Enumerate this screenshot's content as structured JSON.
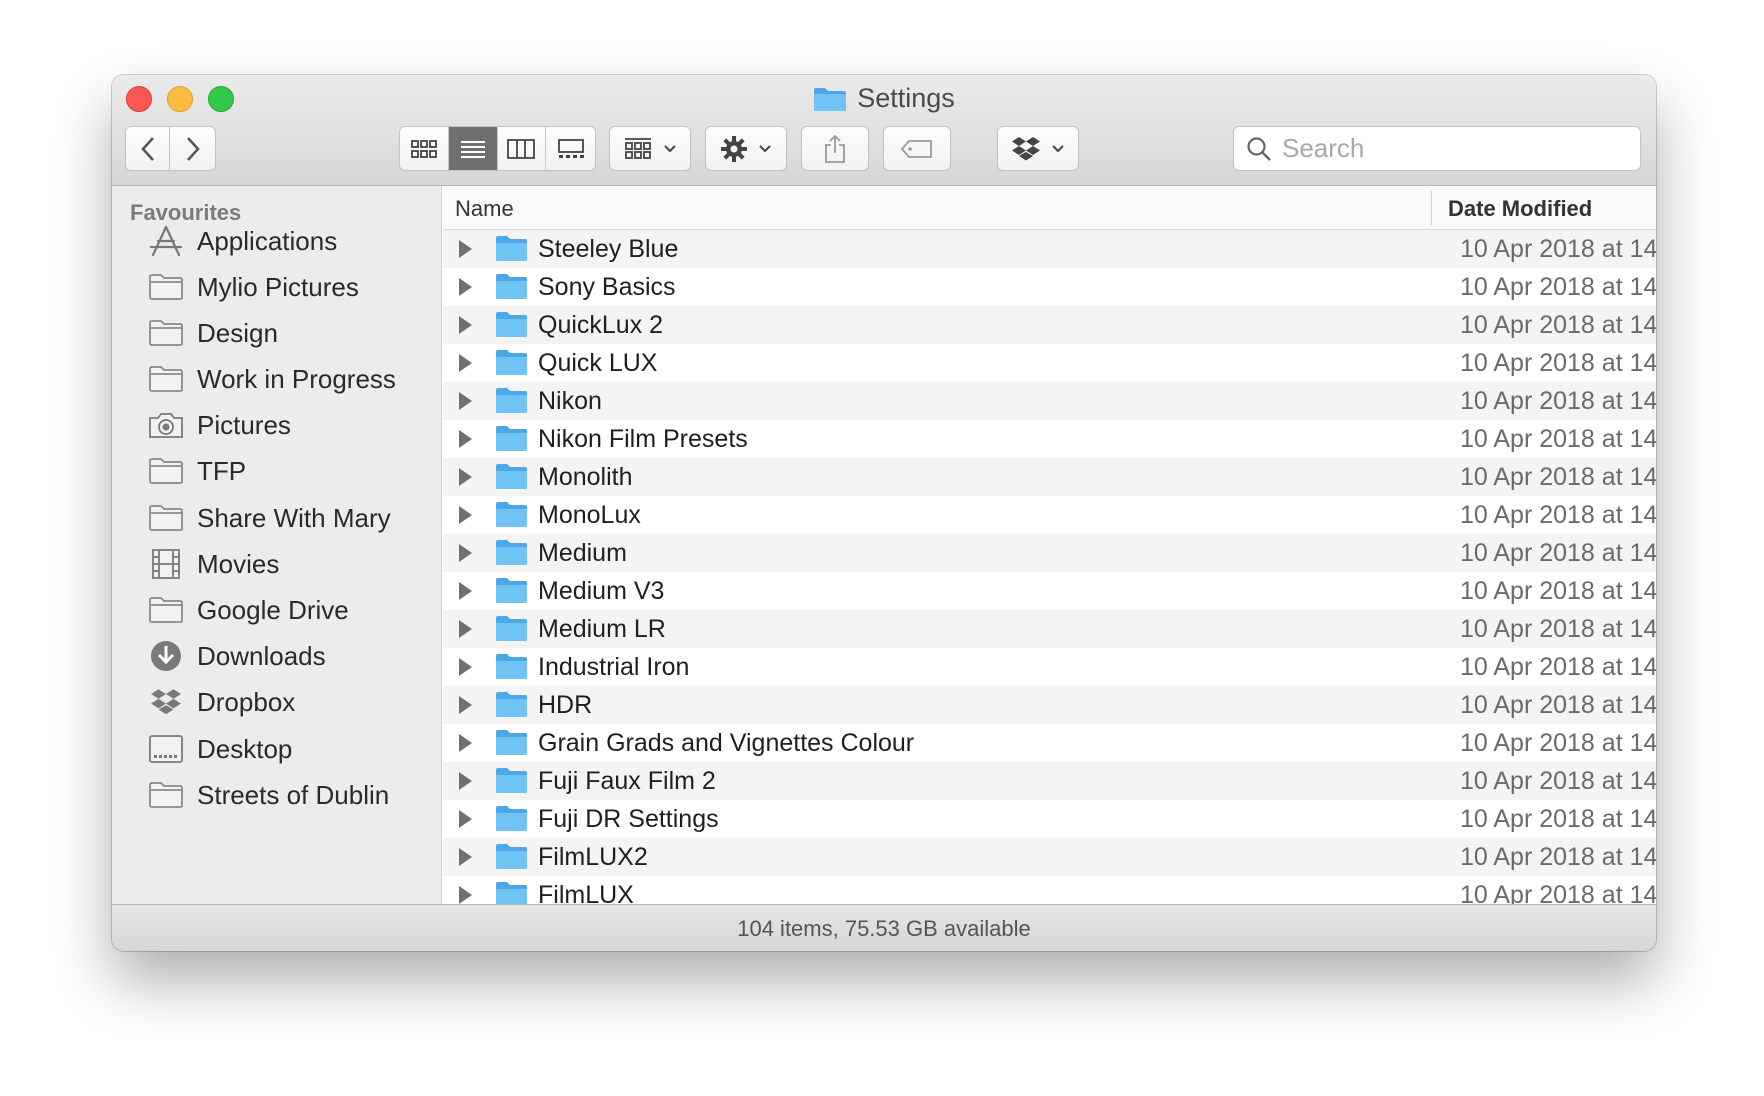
{
  "window": {
    "title": "Settings"
  },
  "toolbar": {
    "back_icon": "chevron-left-icon",
    "forward_icon": "chevron-right-icon",
    "view_modes": [
      "icon-view",
      "list-view",
      "column-view",
      "gallery-view"
    ],
    "active_view": "list-view",
    "group_icon": "group-grid-icon",
    "action_icon": "gear-icon",
    "share_icon": "share-icon",
    "tag_icon": "tag-icon",
    "dropbox_icon": "dropbox-icon"
  },
  "search": {
    "placeholder": "Search",
    "value": ""
  },
  "sidebar": {
    "heading": "Favourites",
    "items": [
      {
        "label": "Applications",
        "icon": "applications-icon"
      },
      {
        "label": "Mylio Pictures",
        "icon": "folder-icon"
      },
      {
        "label": "Design",
        "icon": "folder-icon"
      },
      {
        "label": "Work in Progress",
        "icon": "folder-icon"
      },
      {
        "label": "Pictures",
        "icon": "camera-icon"
      },
      {
        "label": "TFP",
        "icon": "folder-icon"
      },
      {
        "label": "Share With Mary",
        "icon": "folder-icon"
      },
      {
        "label": "Movies",
        "icon": "film-icon"
      },
      {
        "label": "Google Drive",
        "icon": "folder-icon"
      },
      {
        "label": "Downloads",
        "icon": "download-icon"
      },
      {
        "label": "Dropbox",
        "icon": "dropbox-icon"
      },
      {
        "label": "Desktop",
        "icon": "desktop-icon"
      },
      {
        "label": "Streets of Dublin",
        "icon": "folder-icon"
      }
    ]
  },
  "list": {
    "columns": {
      "name": "Name",
      "date": "Date Modified"
    },
    "rows": [
      {
        "name": "Steeley Blue",
        "date": "10 Apr 2018 at 14"
      },
      {
        "name": "Sony Basics",
        "date": "10 Apr 2018 at 14"
      },
      {
        "name": "QuickLux 2",
        "date": "10 Apr 2018 at 14"
      },
      {
        "name": "Quick LUX",
        "date": "10 Apr 2018 at 14"
      },
      {
        "name": "Nikon",
        "date": "10 Apr 2018 at 14"
      },
      {
        "name": "Nikon Film Presets",
        "date": "10 Apr 2018 at 14"
      },
      {
        "name": "Monolith",
        "date": "10 Apr 2018 at 14"
      },
      {
        "name": "MonoLux",
        "date": "10 Apr 2018 at 14"
      },
      {
        "name": "Medium",
        "date": "10 Apr 2018 at 14"
      },
      {
        "name": "Medium V3",
        "date": "10 Apr 2018 at 14"
      },
      {
        "name": "Medium LR",
        "date": "10 Apr 2018 at 14"
      },
      {
        "name": "Industrial Iron",
        "date": "10 Apr 2018 at 14"
      },
      {
        "name": "HDR",
        "date": "10 Apr 2018 at 14"
      },
      {
        "name": "Grain Grads and Vignettes Colour",
        "date": "10 Apr 2018 at 14"
      },
      {
        "name": "Fuji Faux Film 2",
        "date": "10 Apr 2018 at 14"
      },
      {
        "name": "Fuji DR Settings",
        "date": "10 Apr 2018 at 14"
      },
      {
        "name": "FilmLUX2",
        "date": "10 Apr 2018 at 14"
      },
      {
        "name": "FilmLUX",
        "date": "10 Apr 2018 at 14"
      }
    ]
  },
  "status": {
    "text": "104 items, 75.53 GB available"
  },
  "colors": {
    "folder_blue": "#6fc3f5",
    "folder_blue_dark": "#4aa8e6",
    "close": "#fc5753",
    "minimize": "#fdbc40",
    "maximize": "#34c84a"
  }
}
